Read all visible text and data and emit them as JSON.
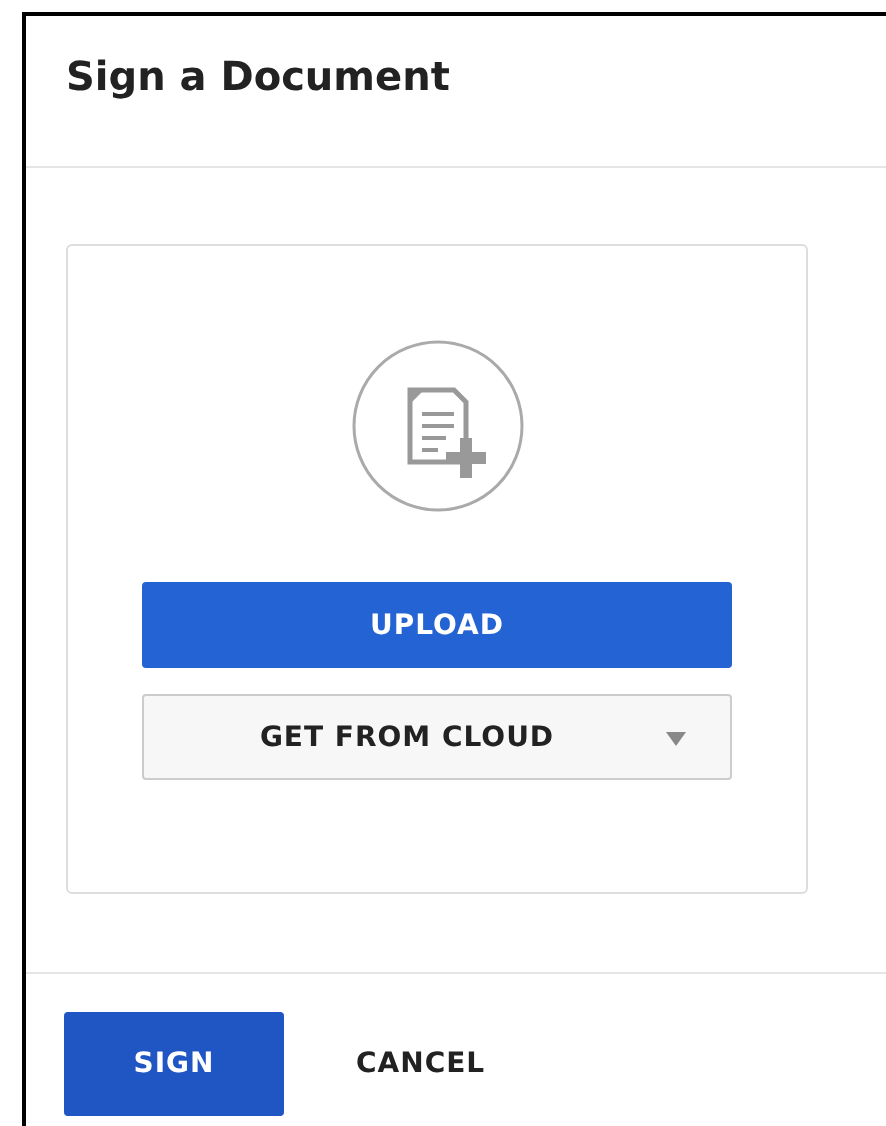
{
  "dialog": {
    "title": "Sign a Document"
  },
  "upload_panel": {
    "buttons": [
      {
        "label": "UPLOAD",
        "kind": "primary"
      },
      {
        "label": "GET FROM CLOUD",
        "kind": "dropdown"
      }
    ]
  },
  "footer": {
    "buttons": [
      {
        "label": "SIGN",
        "kind": "primary"
      },
      {
        "label": "CANCEL",
        "kind": "text"
      }
    ]
  }
}
